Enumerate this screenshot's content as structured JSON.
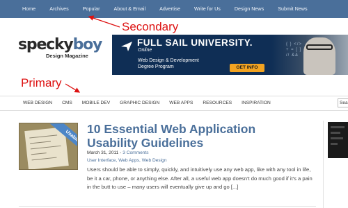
{
  "secondary_nav": {
    "items": [
      "Home",
      "Archives",
      "Popular",
      "About & Email",
      "Advertise",
      "Write for Us",
      "Design News",
      "Submit News"
    ]
  },
  "annotations": {
    "secondary": "Secondary",
    "primary": "Primary",
    "color": "#dd1111"
  },
  "logo": {
    "main_a": "specky",
    "main_b": "boy",
    "tagline": "Design Magazine"
  },
  "ad": {
    "title": "FULL SAIL UNIVERSITY.",
    "subtitle": "Online",
    "program_line1": "Web Design & Development",
    "program_line2": "Degree Program",
    "button": "GET INFO",
    "button_color": "#f2a321",
    "background": "#0f2e55"
  },
  "primary_nav": {
    "items": [
      "WEB DESIGN",
      "CMS",
      "MOBILE DEV",
      "GRAPHIC DESIGN",
      "WEB APPS",
      "RESOURCES",
      "INSPIRATION"
    ]
  },
  "search": {
    "value": "Sea"
  },
  "article": {
    "thumb_badge": "Usability",
    "title": "10 Essential Web Application Usability Guidelines",
    "date": "March 31, 2011",
    "meta_separator": " - ",
    "comments": "3 Comments",
    "categories": [
      "User Interface",
      "Web Apps",
      "Web Design"
    ],
    "category_separator": ", ",
    "excerpt": "Users should be able to simply, quickly, and intuitively use any web app, like with any tool in life, be it a car, phone, or anything else. After all, a useful web app doesn't do much good if it's a pain in the butt to use – many users will eventually give up and go [...]"
  },
  "colors": {
    "brand_blue": "#4a6f9a",
    "top_bar": "#4a6f9a"
  }
}
